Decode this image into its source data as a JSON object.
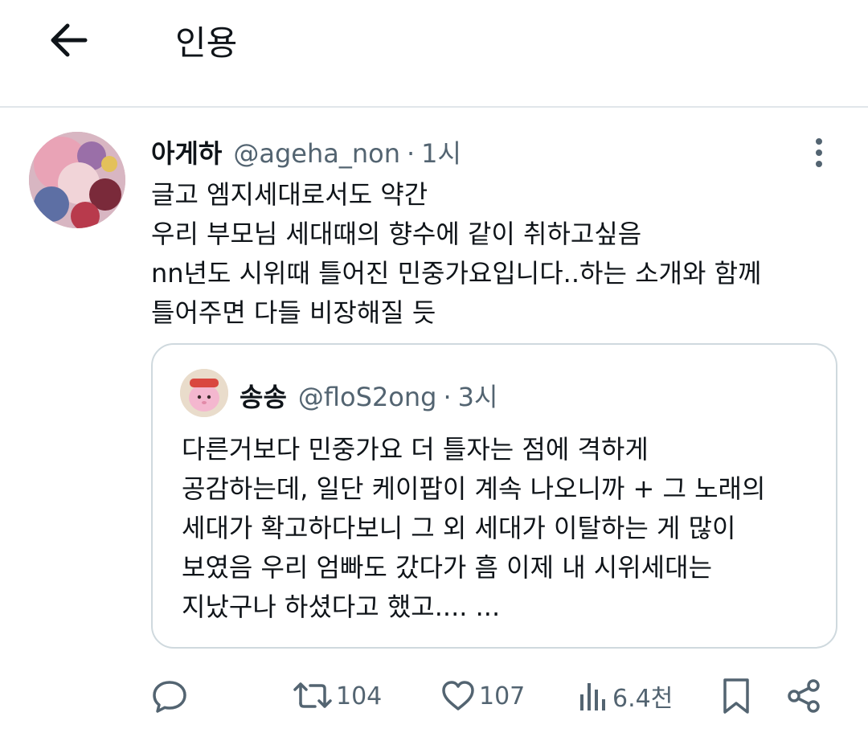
{
  "header": {
    "title": "인용",
    "back_icon": "arrow-left-icon"
  },
  "tweet": {
    "name": "아게하",
    "handle": "@ageha_non",
    "separator": "·",
    "time": "1시",
    "lines": [
      "글고 엠지세대로서도 약간",
      "우리 부모님 세대때의 향수에 같이 취하고싶음",
      "nn년도 시위때 틀어진 민중가요입니다..하는 소개와 함께",
      "틀어주면 다들 비장해질 듯"
    ]
  },
  "quote": {
    "name": "송송",
    "handle": "@floS2ong",
    "separator": "·",
    "time": "3시",
    "lines": [
      "다른거보다 민중가요 더 틀자는 점에 격하게",
      "공감하는데, 일단 케이팝이 계속 나오니까 + 그 노래의",
      "세대가 확고하다보니 그 외 세대가 이탈하는 게 많이",
      "보였음 우리 엄빠도 갔다가 흠 이제 내 시위세대는",
      "지났구나 하셨다고 했고.... ..."
    ]
  },
  "actions": {
    "retweets": "104",
    "likes": "107",
    "views": "6.4천"
  },
  "colors": {
    "text": "#0f1419",
    "secondary": "#536471",
    "border": "#cfd9de",
    "divider": "#e1e6ea"
  }
}
